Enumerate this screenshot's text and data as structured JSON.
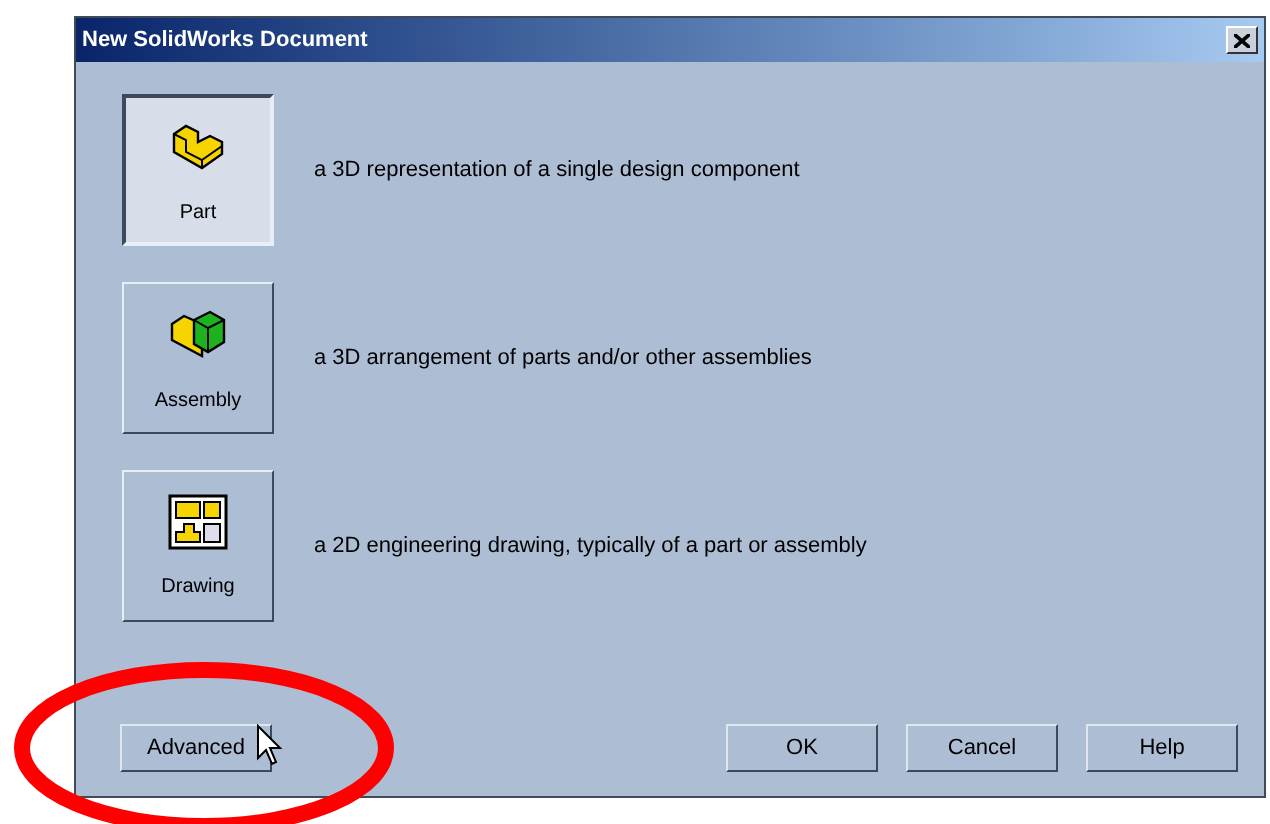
{
  "window": {
    "title": "New SolidWorks Document"
  },
  "document_types": [
    {
      "kind": "part",
      "label": "Part",
      "description": "a 3D representation of a single design component",
      "selected": true
    },
    {
      "kind": "assembly",
      "label": "Assembly",
      "description": "a 3D arrangement of parts and/or other assemblies",
      "selected": false
    },
    {
      "kind": "drawing",
      "label": "Drawing",
      "description": "a 2D engineering drawing, typically of a part or assembly",
      "selected": false
    }
  ],
  "buttons": {
    "left": "Advanced",
    "right": [
      "OK",
      "Cancel",
      "Help"
    ]
  }
}
